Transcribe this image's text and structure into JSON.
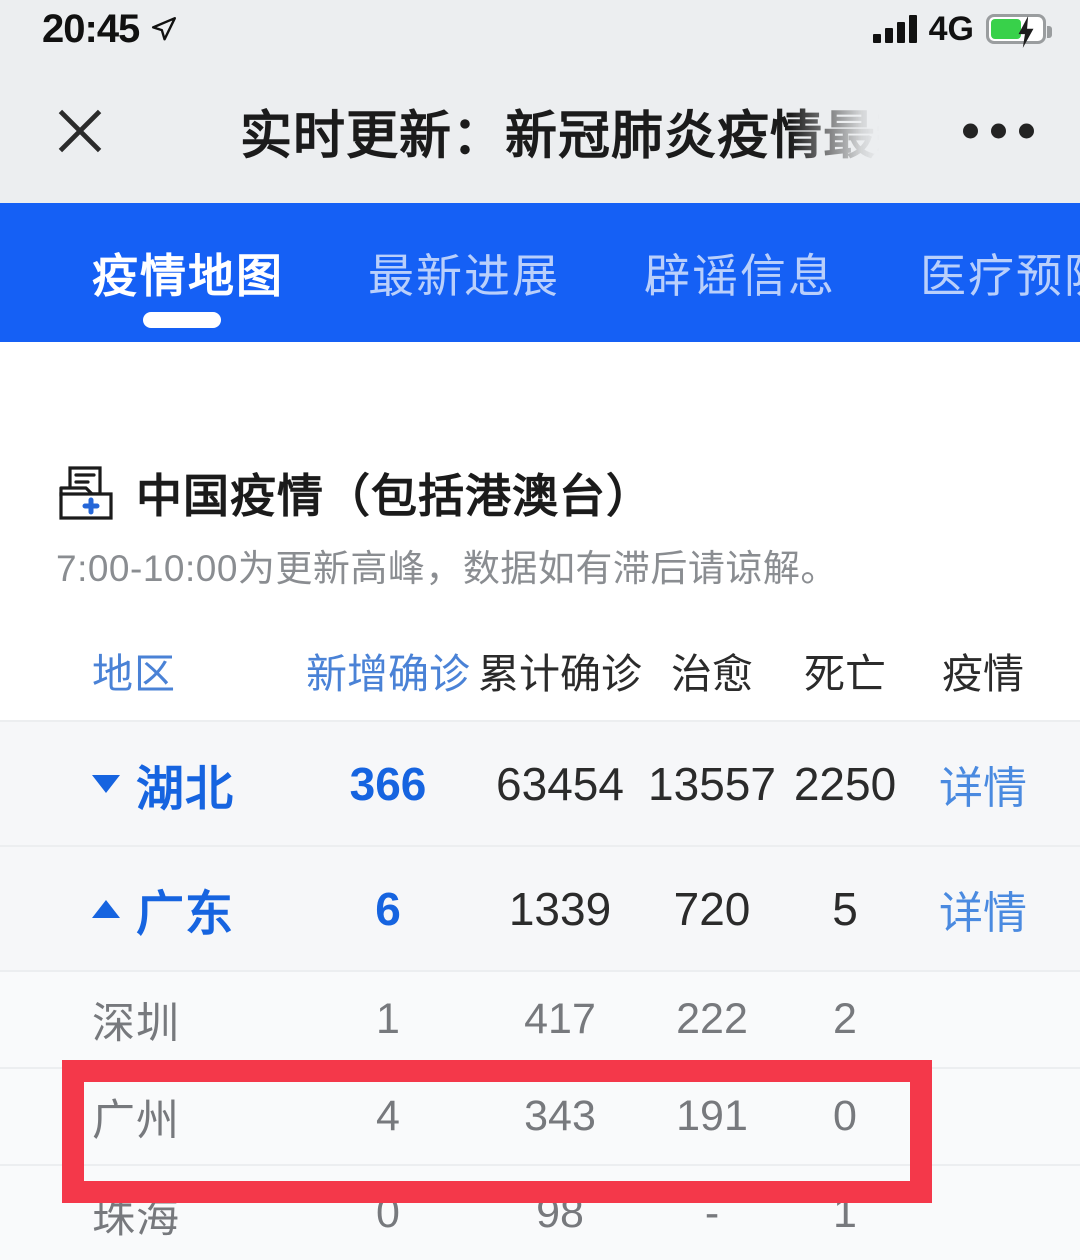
{
  "status_bar": {
    "time": "20:45",
    "location_icon": "location-arrow-icon",
    "signal_icon": "signal-bars-icon",
    "network": "4G",
    "battery_icon": "battery-charging-icon",
    "battery_level_pct": 55
  },
  "title_bar": {
    "close_icon": "close-x-icon",
    "title": "实时更新：新冠肺炎疫情最新",
    "more_icon": "more-dots-icon"
  },
  "tab_bar": {
    "accent_color": "#1560f5",
    "active_index": 0,
    "tabs": [
      {
        "label": "疫情地图"
      },
      {
        "label": "最新进展"
      },
      {
        "label": "辟谣信息"
      },
      {
        "label": "医疗预防"
      }
    ]
  },
  "section": {
    "icon": "medical-folder-icon",
    "title": "中国疫情（包括港澳台）",
    "subtitle": "7:00-10:00为更新高峰，数据如有滞后请谅解。"
  },
  "table": {
    "headers": {
      "region": "地区",
      "new_confirmed": "新增确诊",
      "total_confirmed": "累计确诊",
      "cured": "治愈",
      "deaths": "死亡",
      "epidemic": "疫情"
    },
    "rows": [
      {
        "type": "province",
        "caret": "down",
        "region": "湖北",
        "new_confirmed": "366",
        "total_confirmed": "63454",
        "cured": "13557",
        "deaths": "2250",
        "detail": "详情"
      },
      {
        "type": "province",
        "caret": "up",
        "region": "广东",
        "new_confirmed": "6",
        "total_confirmed": "1339",
        "cured": "720",
        "deaths": "5",
        "detail": "详情"
      },
      {
        "type": "city",
        "region": "深圳",
        "new_confirmed": "1",
        "total_confirmed": "417",
        "cured": "222",
        "deaths": "2"
      },
      {
        "type": "city",
        "region": "广州",
        "new_confirmed": "4",
        "total_confirmed": "343",
        "cured": "191",
        "deaths": "0",
        "highlighted": true
      },
      {
        "type": "city",
        "region": "珠海",
        "new_confirmed": "0",
        "total_confirmed": "98",
        "cured": "-",
        "deaths": "1"
      }
    ]
  },
  "annotation": {
    "highlight_color": "#f4384a",
    "highlight_target": "广州"
  }
}
